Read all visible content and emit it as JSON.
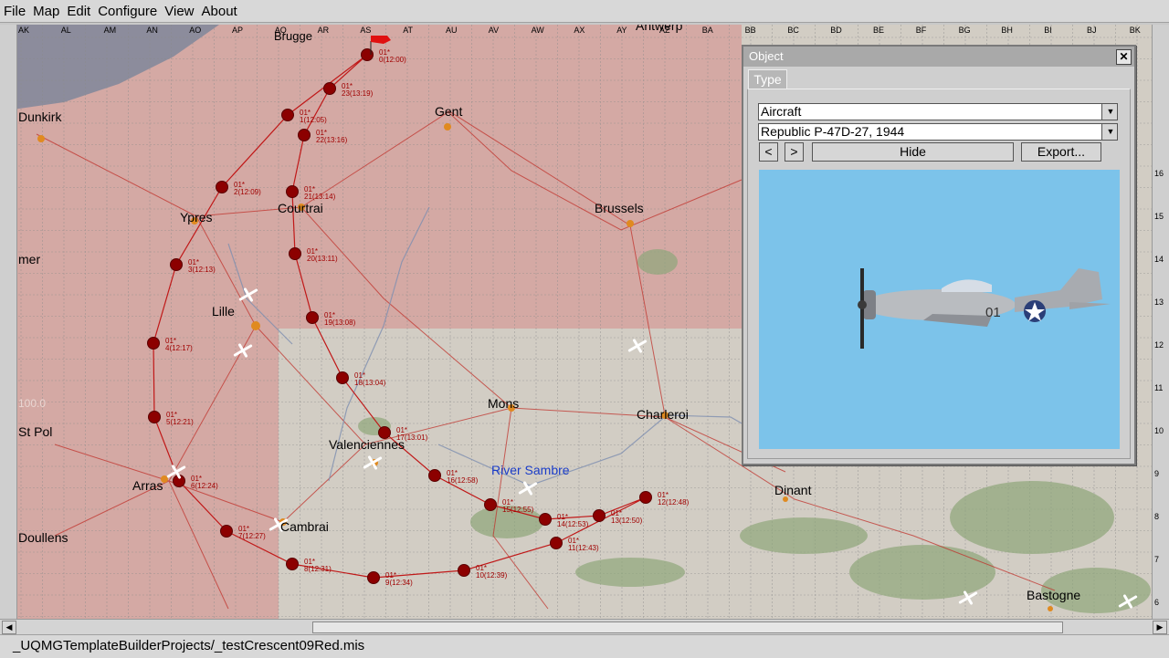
{
  "menu": [
    "File",
    "Map",
    "Edit",
    "Configure",
    "View",
    "About"
  ],
  "map": {
    "columns": [
      "AK",
      "AL",
      "AM",
      "AN",
      "AO",
      "AP",
      "AQ",
      "AR",
      "AS",
      "AT",
      "AU",
      "AV",
      "AW",
      "AX",
      "AY",
      "AZ",
      "BA",
      "BB",
      "BC",
      "BD",
      "BE",
      "BF",
      "BG",
      "BH",
      "BI",
      "BJ",
      "BK"
    ],
    "rows": [
      "16",
      "15",
      "14",
      "13",
      "12",
      "11",
      "10",
      "9",
      "8",
      "7",
      "6"
    ],
    "cities": [
      "Brugge",
      "Gent",
      "Dunkirk",
      "Ypres",
      "Courtrai",
      "Brussels",
      "mer",
      "Lille",
      "Mons",
      "Charleroi",
      "St Pol",
      "Valenciennes",
      "Arras",
      "Cambrai",
      "Doullens",
      "Dinant",
      "Bastogne",
      "Antwerp"
    ],
    "river": "River Sambre",
    "faded_value": "100.0",
    "waypoints": [
      {
        "unit": "01*",
        "info": "0(12:00)"
      },
      {
        "unit": "01*",
        "info": "23(13:19)"
      },
      {
        "unit": "01*",
        "info": "1(12:05)"
      },
      {
        "unit": "01*",
        "info": "22(13:16)"
      },
      {
        "unit": "01*",
        "info": "2(12:09)"
      },
      {
        "unit": "01*",
        "info": "21(13:14)"
      },
      {
        "unit": "01*",
        "info": "20(13:11)"
      },
      {
        "unit": "01*",
        "info": "3(12:13)"
      },
      {
        "unit": "01*",
        "info": "19(13:08)"
      },
      {
        "unit": "01*",
        "info": "4(12:17)"
      },
      {
        "unit": "01*",
        "info": "18(13:04)"
      },
      {
        "unit": "01*",
        "info": "5(12:21)"
      },
      {
        "unit": "01*",
        "info": "17(13:01)"
      },
      {
        "unit": "01*",
        "info": "6(12:24)"
      },
      {
        "unit": "01*",
        "info": "16(12:58)"
      },
      {
        "unit": "01*",
        "info": "15(12:55)"
      },
      {
        "unit": "01*",
        "info": "14(12:53)"
      },
      {
        "unit": "01*",
        "info": "13(12:50)"
      },
      {
        "unit": "01*",
        "info": "12(12:48)"
      },
      {
        "unit": "01*",
        "info": "11(12:43)"
      },
      {
        "unit": "01*",
        "info": "10(12:39)"
      },
      {
        "unit": "01*",
        "info": "9(12:34)"
      },
      {
        "unit": "01*",
        "info": "8(12:31)"
      },
      {
        "unit": "01*",
        "info": "7(12:27)"
      }
    ]
  },
  "dialog": {
    "title": "Object",
    "tab": "Type",
    "type_value": "Aircraft",
    "model_value": "Republic P-47D-27, 1944",
    "prev_label": "<",
    "next_label": ">",
    "hide_label": "Hide",
    "export_label": "Export...",
    "aircraft_code": "01"
  },
  "colors": {
    "red_zone": "#d4a9a4",
    "neutral_zone": "#d3cec6",
    "route": "#c01818",
    "waypoint": "#8c0000",
    "sea": "#8c8c9c",
    "sky": "#7cc3ea"
  },
  "statusbar": {
    "path": "_UQMGTemplateBuilderProjects/_testCrescent09Red.mis"
  }
}
